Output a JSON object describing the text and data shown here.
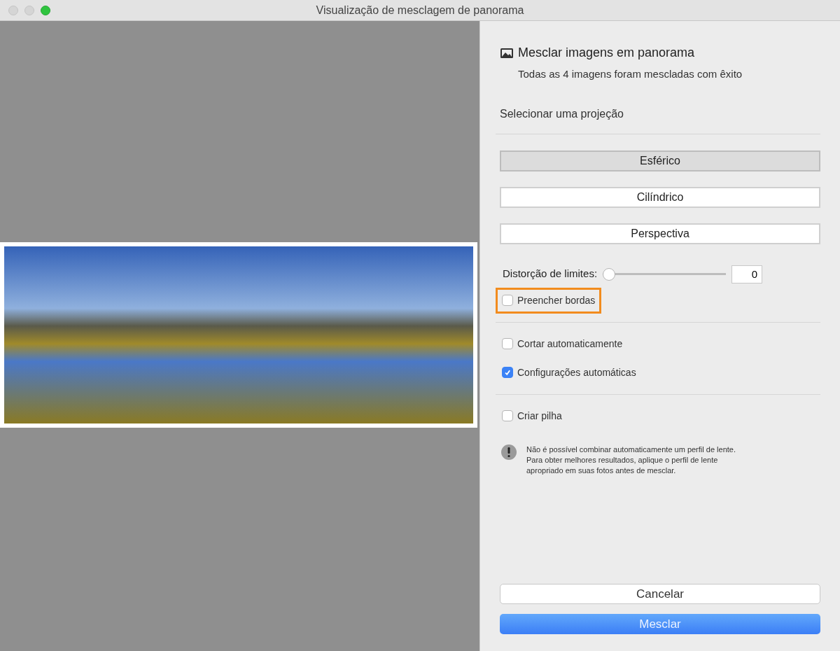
{
  "window": {
    "title": "Visualização de mesclagem de panorama"
  },
  "panel": {
    "title": "Mesclar imagens em panorama",
    "subtitle": "Todas as 4 imagens foram mescladas com êxito",
    "projection_heading": "Selecionar uma projeção",
    "projections": [
      {
        "label": "Esférico",
        "selected": true
      },
      {
        "label": "Cilíndrico",
        "selected": false
      },
      {
        "label": "Perspectiva",
        "selected": false
      }
    ],
    "boundary_warp": {
      "label": "Distorção de limites:",
      "level": 0,
      "value": "0"
    },
    "option_groups": [
      [
        {
          "label": "Preencher bordas",
          "checked": false,
          "highlighted": true
        }
      ],
      [
        {
          "label": "Cortar automaticamente",
          "checked": false,
          "highlighted": false
        },
        {
          "label": "Configurações automáticas",
          "checked": true,
          "highlighted": false
        }
      ],
      [
        {
          "label": "Criar pilha",
          "checked": false,
          "highlighted": false
        }
      ]
    ],
    "notice": "Não é possível combinar automaticamente um perfil de lente. Para obter melhores resultados, aplique o perfil de lente apropriado em suas fotos antes de mesclar.",
    "buttons": [
      {
        "label": "Cancelar",
        "kind": "secondary"
      },
      {
        "label": "Mesclar",
        "kind": "primary"
      }
    ]
  }
}
